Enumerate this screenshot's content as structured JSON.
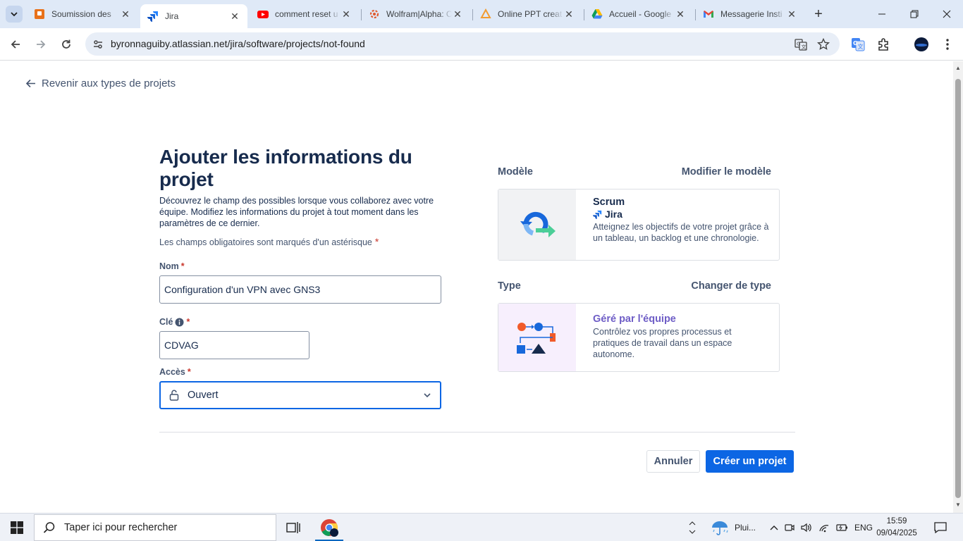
{
  "browser": {
    "tabs": [
      {
        "title": "Soumission des ",
        "icon": "orange-square-icon"
      },
      {
        "title": "Jira",
        "icon": "jira-icon",
        "active": true
      },
      {
        "title": "comment reset u",
        "icon": "youtube-icon"
      },
      {
        "title": "Wolfram|Alpha: C",
        "icon": "wolfram-icon"
      },
      {
        "title": "Online PPT creat",
        "icon": "ppt-creator-icon"
      },
      {
        "title": "Accueil - Google",
        "icon": "google-drive-icon"
      },
      {
        "title": "Messagerie Insti",
        "icon": "gmail-icon"
      }
    ],
    "url": "byronnaguiby.atlassian.net/jira/software/projects/not-found"
  },
  "page": {
    "back_link": "Revenir aux types de projets",
    "title": "Ajouter les informations du projet",
    "description": "Découvrez le champ des possibles lorsque vous collaborez avec votre équipe. Modifiez les informations du projet à tout moment dans les paramètres de ce dernier.",
    "required_note": "Les champs obligatoires sont marqués d'un astérisque",
    "asterisk": "*",
    "fields": {
      "name_label": "Nom",
      "name_value": "Configuration d'un VPN avec GNS3",
      "key_label": "Clé",
      "key_value": "CDVAG",
      "access_label": "Accès",
      "access_value": "Ouvert"
    },
    "template": {
      "heading": "Modèle",
      "action": "Modifier le modèle",
      "name": "Scrum",
      "product": "Jira",
      "description": "Atteignez les objectifs de votre projet grâce à un tableau, un backlog et une chronologie."
    },
    "type": {
      "heading": "Type",
      "action": "Changer de type",
      "name": "Géré par l'équipe",
      "description": "Contrôlez vos propres processus et pratiques de travail dans un espace autonome."
    },
    "buttons": {
      "cancel": "Annuler",
      "create": "Créer un projet"
    }
  },
  "taskbar": {
    "search_placeholder": "Taper ici pour rechercher",
    "weather": "Plui...",
    "language": "ENG",
    "time": "15:59",
    "date": "09/04/2025"
  },
  "colors": {
    "primary": "#0c66e4",
    "required": "#c9372c",
    "type_title": "#6e5dc6"
  }
}
